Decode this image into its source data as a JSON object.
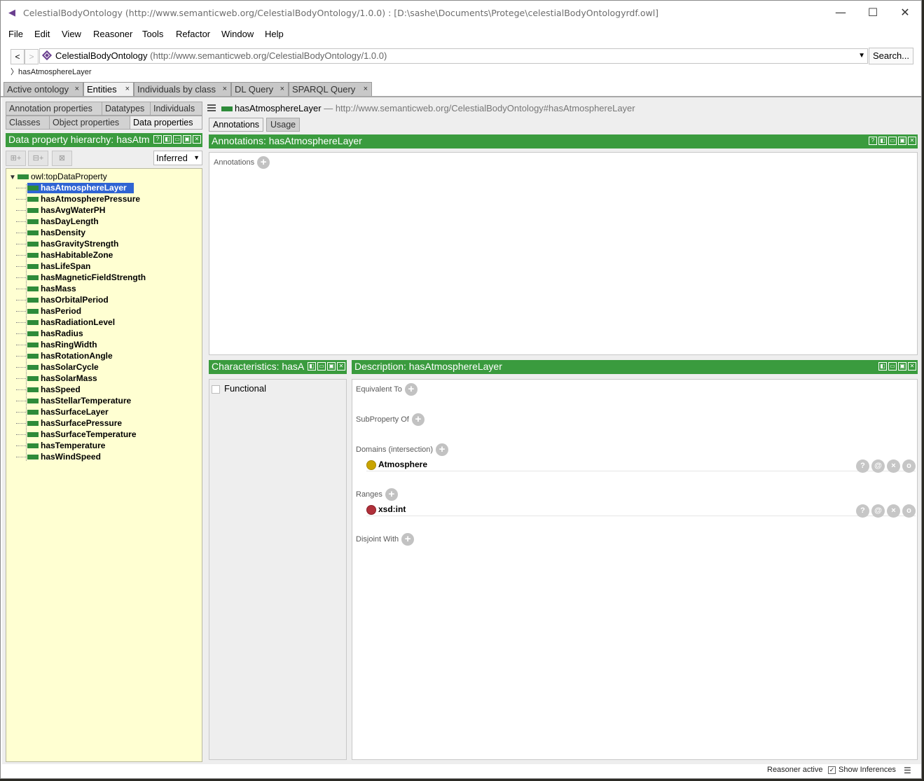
{
  "window": {
    "title": "CelestialBodyOntology (http://www.semanticweb.org/CelestialBodyOntology/1.0.0)  : [D:\\sashe\\Documents\\Protege\\celestialBodyOntologyrdf.owl]",
    "minimize": "—",
    "maximize": "☐",
    "close": "✕"
  },
  "menu": [
    "File",
    "Edit",
    "View",
    "Reasoner",
    "Tools",
    "Refactor",
    "Window",
    "Help"
  ],
  "toolbar": {
    "back": "<",
    "forward": ">",
    "ontology_name": "CelestialBodyOntology",
    "ontology_uri": "(http://www.semanticweb.org/CelestialBodyOntology/1.0.0)",
    "search_label": "Search...",
    "breadcrumb": "hasAtmosphereLayer"
  },
  "tabs": [
    {
      "label": "Active ontology",
      "close": "×"
    },
    {
      "label": "Entities",
      "close": "×"
    },
    {
      "label": "Individuals by class",
      "close": "×"
    },
    {
      "label": "DL Query",
      "close": "×"
    },
    {
      "label": "SPARQL Query",
      "close": "×"
    }
  ],
  "left": {
    "subtabs": [
      "Annotation properties",
      "Datatypes",
      "Individuals",
      "Classes",
      "Object properties",
      "Data properties"
    ],
    "header": "Data property hierarchy: hasAtm",
    "header_icons": [
      "?",
      "◧",
      "▭",
      "▣",
      "✕"
    ],
    "view_mode": "Inferred",
    "root": "owl:topDataProperty",
    "items": [
      "hasAtmosphereLayer",
      "hasAtmospherePressure",
      "hasAvgWaterPH",
      "hasDayLength",
      "hasDensity",
      "hasGravityStrength",
      "hasHabitableZone",
      "hasLifeSpan",
      "hasMagneticFieldStrength",
      "hasMass",
      "hasOrbitalPeriod",
      "hasPeriod",
      "hasRadiationLevel",
      "hasRadius",
      "hasRingWidth",
      "hasRotationAngle",
      "hasSolarCycle",
      "hasSolarMass",
      "hasSpeed",
      "hasStellarTemperature",
      "hasSurfaceLayer",
      "hasSurfacePressure",
      "hasSurfaceTemperature",
      "hasTemperature",
      "hasWindSpeed"
    ],
    "selected": "hasAtmosphereLayer"
  },
  "entity": {
    "name": "hasAtmosphereLayer",
    "sep": "—",
    "uri": "http://www.semanticweb.org/CelestialBodyOntology#hasAtmosphereLayer",
    "tabs": [
      "Annotations",
      "Usage"
    ]
  },
  "annotations": {
    "header": "Annotations: hasAtmosphereLayer",
    "label": "Annotations"
  },
  "characteristics": {
    "header": "Characteristics: hasA",
    "functional": "Functional"
  },
  "description": {
    "header": "Description: hasAtmosphereLayer",
    "equivalent": "Equivalent To",
    "subproperty": "SubProperty Of",
    "domains": "Domains (intersection)",
    "domain_value": "Atmosphere",
    "ranges": "Ranges",
    "range_value": "xsd:int",
    "disjoint": "Disjoint With",
    "row_icons": [
      "?",
      "@",
      "×",
      "o"
    ]
  },
  "status": {
    "reasoner": "Reasoner active",
    "show_inferences": "Show Inferences",
    "show_inferences_checked": true
  },
  "colors": {
    "green_header": "#3a9b3e",
    "tree_bg": "#ffffd2",
    "selection": "#2f64d3",
    "domain_dot": "#c9a400",
    "range_dot": "#b0303a"
  },
  "plus": "+"
}
